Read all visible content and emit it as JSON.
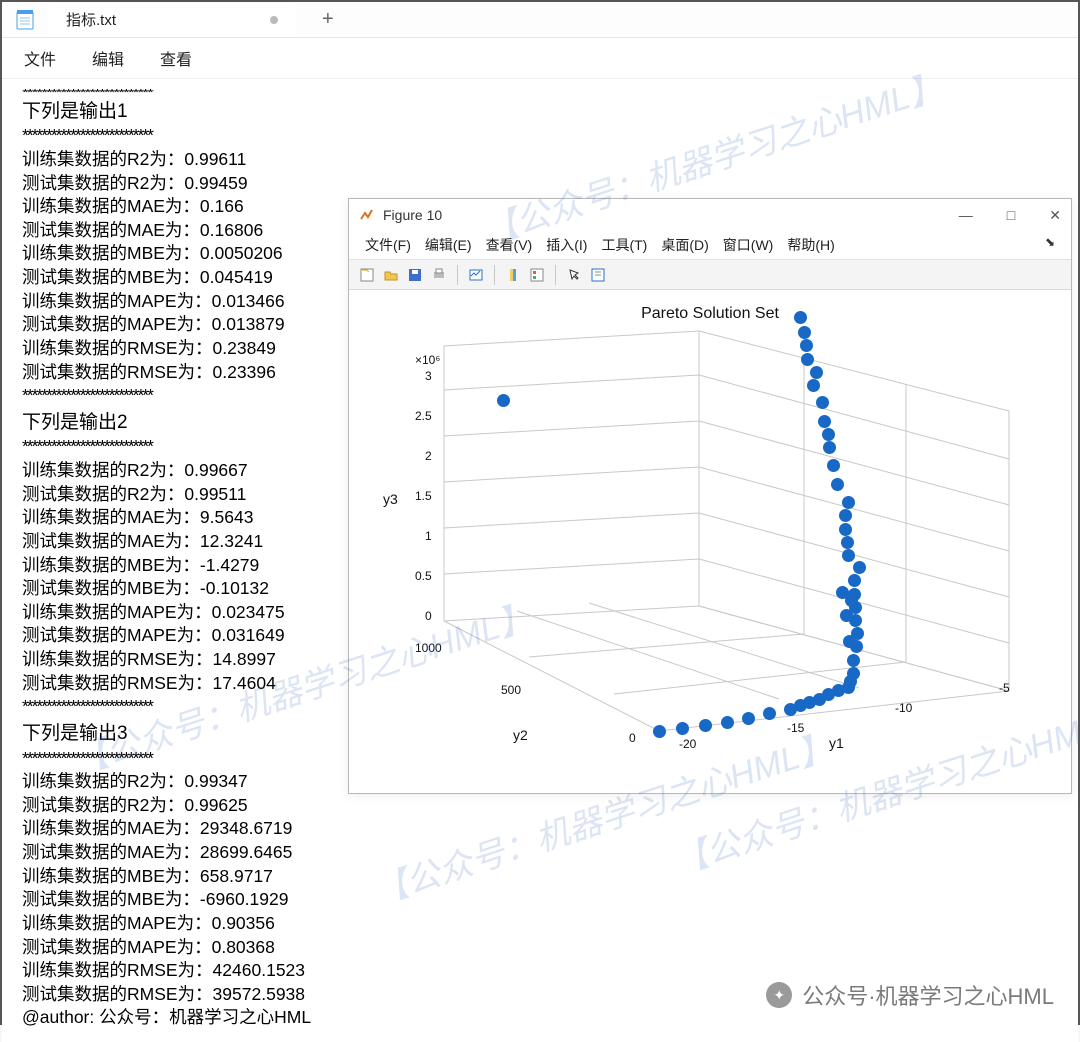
{
  "tab": {
    "filename": "指标.txt",
    "new_tab_glyph": "+"
  },
  "menu": {
    "file": "文件",
    "edit": "编辑",
    "view": "查看"
  },
  "text": {
    "stars": "***************************",
    "s1_h": "下列是输出1",
    "s1": [
      "训练集数据的R2为：0.99611",
      "测试集数据的R2为：0.99459",
      "训练集数据的MAE为：0.166",
      "测试集数据的MAE为：0.16806",
      "训练集数据的MBE为：0.0050206",
      "测试集数据的MBE为：0.045419",
      "训练集数据的MAPE为：0.013466",
      "测试集数据的MAPE为：0.013879",
      "训练集数据的RMSE为：0.23849",
      "测试集数据的RMSE为：0.23396"
    ],
    "s2_h": "下列是输出2",
    "s2": [
      "训练集数据的R2为：0.99667",
      "测试集数据的R2为：0.99511",
      "训练集数据的MAE为：9.5643",
      "测试集数据的MAE为：12.3241",
      "训练集数据的MBE为：-1.4279",
      "测试集数据的MBE为：-0.10132",
      "训练集数据的MAPE为：0.023475",
      "测试集数据的MAPE为：0.031649",
      "训练集数据的RMSE为：14.8997",
      "测试集数据的RMSE为：17.4604"
    ],
    "s3_h": "下列是输出3",
    "s3": [
      "训练集数据的R2为：0.99347",
      "测试集数据的R2为：0.99625",
      "训练集数据的MAE为：29348.6719",
      "测试集数据的MAE为：28699.6465",
      "训练集数据的MBE为：658.9717",
      "测试集数据的MBE为：-6960.1929",
      "训练集数据的MAPE为：0.90356",
      "测试集数据的MAPE为：0.80368",
      "训练集数据的RMSE为：42460.1523",
      "测试集数据的RMSE为：39572.5938",
      "@author: 公众号：机器学习之心HML"
    ]
  },
  "fig": {
    "title": "Figure 10",
    "menu": {
      "file": "文件(F)",
      "edit": "编辑(E)",
      "view": "查看(V)",
      "insert": "插入(I)",
      "tool": "工具(T)",
      "desktop": "桌面(D)",
      "window": "窗口(W)",
      "help": "帮助(H)"
    },
    "plot_title": "Pareto Solution Set",
    "xlabel": "y1",
    "ylabel": "y2",
    "zlabel": "y3",
    "mult": "×10⁶",
    "zticks": [
      "0",
      "0.5",
      "1",
      "1.5",
      "2",
      "2.5",
      "3"
    ],
    "yticks": [
      "0",
      "500",
      "1000"
    ],
    "xticks": [
      "-20",
      "-15",
      "-10",
      "-5"
    ]
  },
  "watermarks": {
    "w1": "【公众号：机器学习之心HML】",
    "w2": "【公众号：机器学习之心HML】",
    "w3": "【公众号：机器学习之心HML】",
    "w4": "【公众号：机器学习之心HML】",
    "footer": "公众号·机器学习之心HML"
  },
  "chart_data": {
    "type": "scatter",
    "title": "Pareto Solution Set",
    "xlabel": "y1",
    "ylabel": "y2",
    "zlabel": "y3",
    "xlim": [
      -20,
      -5
    ],
    "ylim": [
      0,
      1000
    ],
    "zlim": [
      0,
      3000000
    ],
    "z_multiplier_label": "×10^6",
    "series": [
      {
        "name": "pareto",
        "points": [
          {
            "y1": -5.2,
            "y2": 950,
            "y3": 2950000
          },
          {
            "y1": -5.5,
            "y2": 900,
            "y3": 2850000
          },
          {
            "y1": -5.7,
            "y2": 870,
            "y3": 2750000
          },
          {
            "y1": -6.0,
            "y2": 830,
            "y3": 2650000
          },
          {
            "y1": -5.9,
            "y2": 800,
            "y3": 2550000
          },
          {
            "y1": -6.3,
            "y2": 770,
            "y3": 2450000
          },
          {
            "y1": -6.2,
            "y2": 740,
            "y3": 2300000
          },
          {
            "y1": -6.5,
            "y2": 700,
            "y3": 2150000
          },
          {
            "y1": -6.6,
            "y2": 670,
            "y3": 2050000
          },
          {
            "y1": -6.8,
            "y2": 640,
            "y3": 1950000
          },
          {
            "y1": -7.0,
            "y2": 600,
            "y3": 1800000
          },
          {
            "y1": -7.2,
            "y2": 560,
            "y3": 1650000
          },
          {
            "y1": -7.1,
            "y2": 520,
            "y3": 1500000
          },
          {
            "y1": -7.5,
            "y2": 490,
            "y3": 1400000
          },
          {
            "y1": -7.8,
            "y2": 460,
            "y3": 1300000
          },
          {
            "y1": -8.0,
            "y2": 430,
            "y3": 1200000
          },
          {
            "y1": -8.2,
            "y2": 400,
            "y3": 1100000
          },
          {
            "y1": -8.0,
            "y2": 370,
            "y3": 1000000
          },
          {
            "y1": -8.5,
            "y2": 340,
            "y3": 900000
          },
          {
            "y1": -8.8,
            "y2": 310,
            "y3": 800000
          },
          {
            "y1": -9.0,
            "y2": 280,
            "y3": 700000
          },
          {
            "y1": -9.3,
            "y2": 250,
            "y3": 600000
          },
          {
            "y1": -9.5,
            "y2": 220,
            "y3": 500000
          },
          {
            "y1": -9.8,
            "y2": 190,
            "y3": 400000
          },
          {
            "y1": -10.2,
            "y2": 160,
            "y3": 300000
          },
          {
            "y1": -10.5,
            "y2": 130,
            "y3": 200000
          },
          {
            "y1": -11.0,
            "y2": 100,
            "y3": 100000
          },
          {
            "y1": -12.0,
            "y2": 80,
            "y3": 70000
          },
          {
            "y1": -13.0,
            "y2": 60,
            "y3": 40000
          },
          {
            "y1": -14.0,
            "y2": 40,
            "y3": 20000
          },
          {
            "y1": -15.0,
            "y2": 30,
            "y3": 10000
          },
          {
            "y1": -16.0,
            "y2": 20,
            "y3": 0
          },
          {
            "y1": -17.0,
            "y2": 10,
            "y3": 0
          },
          {
            "y1": -18.0,
            "y2": 5,
            "y3": 0
          },
          {
            "y1": -19.0,
            "y2": 0,
            "y3": 0
          },
          {
            "y1": -20.0,
            "y2": 0,
            "y3": 0
          },
          {
            "y1": -9.0,
            "y2": 300,
            "y3": 750000
          },
          {
            "y1": -9.2,
            "y2": 320,
            "y3": 820000
          },
          {
            "y1": -9.6,
            "y2": 260,
            "y3": 650000
          },
          {
            "y1": -10.0,
            "y2": 200,
            "y3": 450000
          },
          {
            "y1": -10.8,
            "y2": 110,
            "y3": 150000
          },
          {
            "y1": -11.5,
            "y2": 90,
            "y3": 90000
          },
          {
            "y1": -12.5,
            "y2": 70,
            "y3": 50000
          },
          {
            "y1": -13.5,
            "y2": 50,
            "y3": 30000
          },
          {
            "y1": -18.5,
            "y2": 890,
            "y3": 2500000
          }
        ]
      }
    ]
  }
}
